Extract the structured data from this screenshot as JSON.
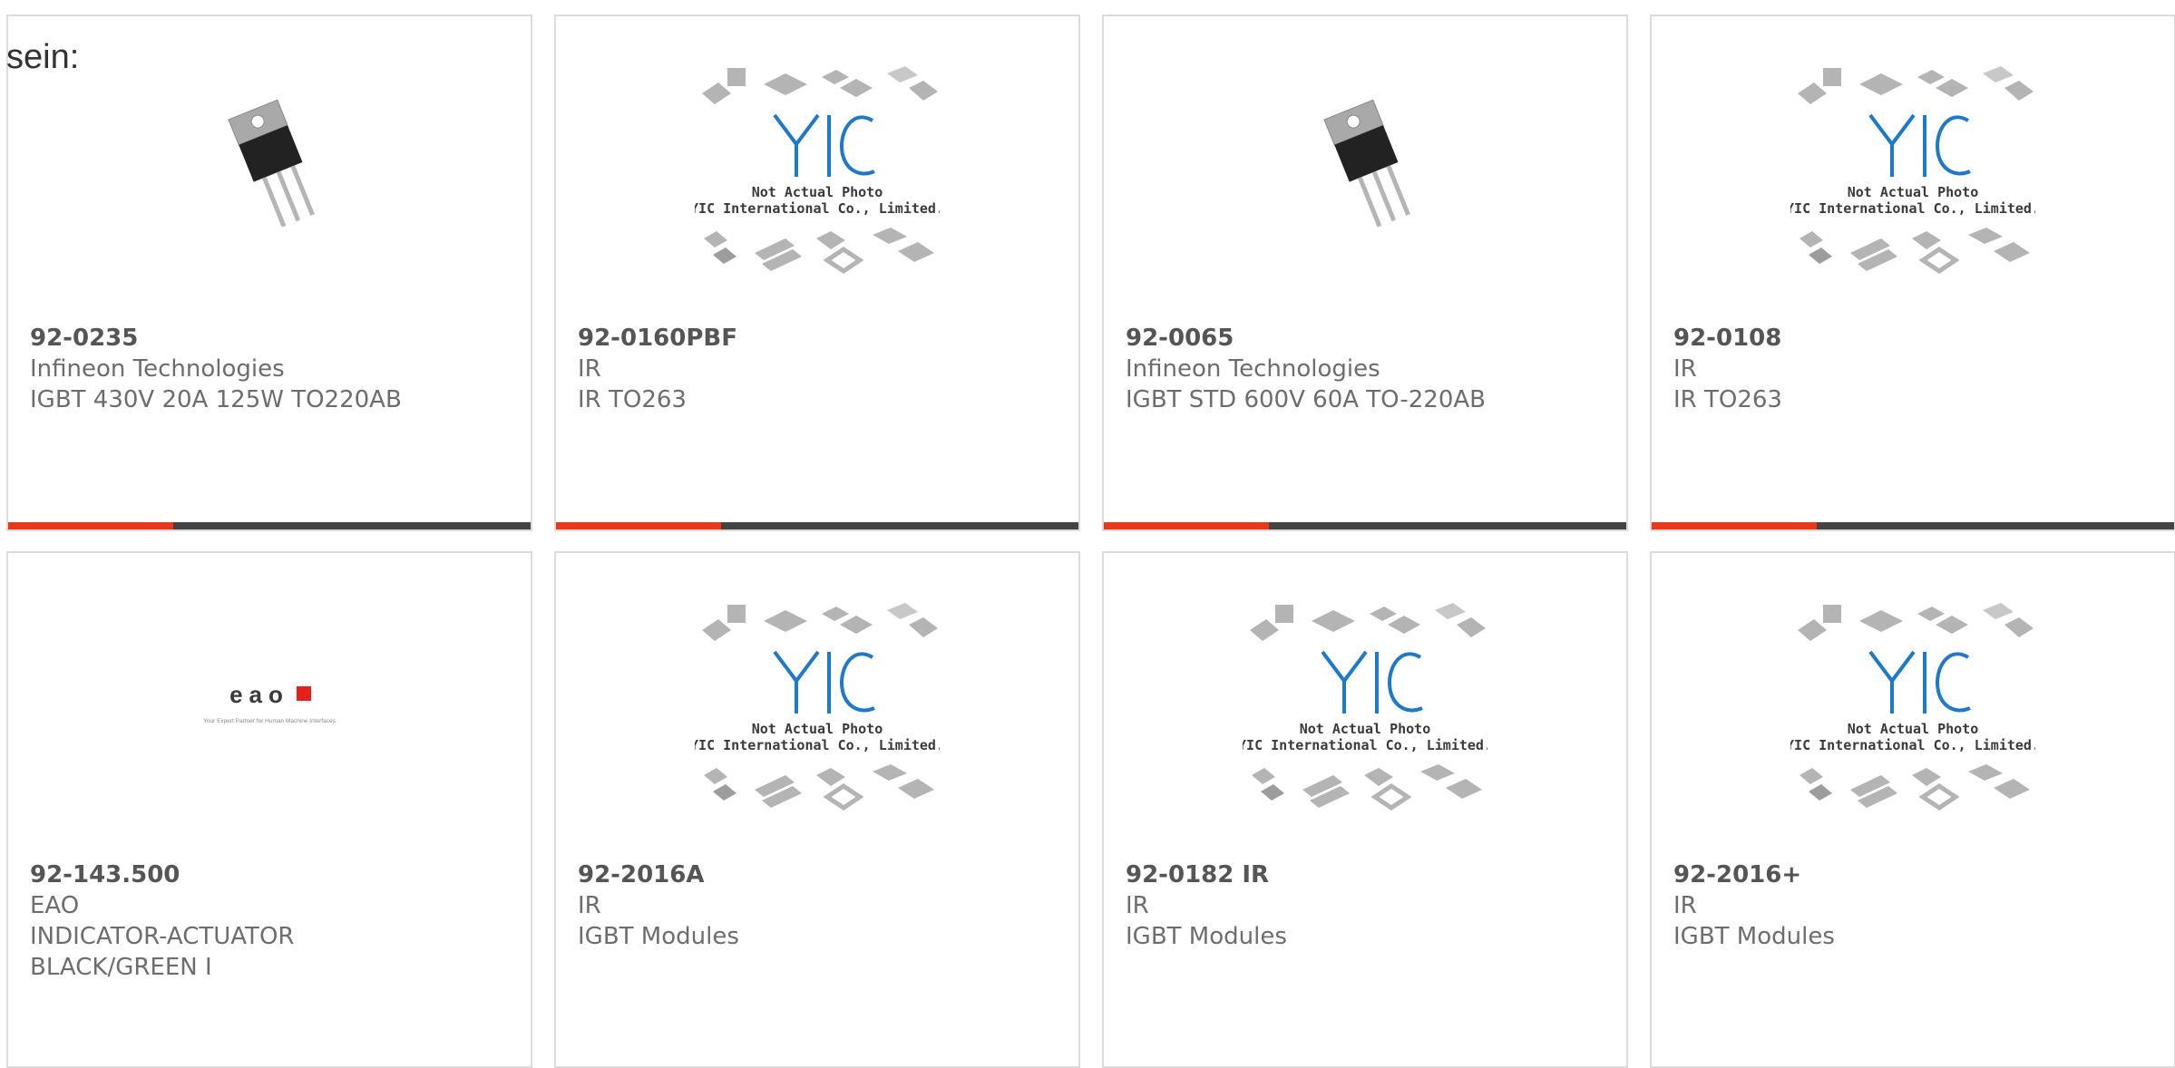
{
  "intro": "sein:",
  "placeholder": {
    "line1": "Not Actual Photo",
    "line2": "YIC International Co., Limited."
  },
  "eao": {
    "brand": "eao",
    "tagline": "Your Expert Partner for Human Machine Interfaces"
  },
  "colors": {
    "accent": "#e8391b",
    "bar": "#444444",
    "yic_blue": "#1f78c8"
  },
  "products": [
    {
      "part": "92-0235",
      "brand": "Infineon Technologies",
      "desc": "IGBT 430V 20A 125W TO220AB",
      "image": "to220-transistor-image"
    },
    {
      "part": "92-0160PBF",
      "brand": "IR",
      "desc": "IR TO263",
      "image": "yic-placeholder-image"
    },
    {
      "part": "92-0065",
      "brand": "Infineon Technologies",
      "desc": "IGBT STD 600V 60A TO-220AB",
      "image": "to220-transistor-image"
    },
    {
      "part": "92-0108",
      "brand": "IR",
      "desc": "IR TO263",
      "image": "yic-placeholder-image"
    },
    {
      "part": "92-143.500",
      "brand": "EAO",
      "desc": "INDICATOR-ACTUATOR",
      "desc2": "BLACK/GREEN I",
      "image": "eao-logo-image"
    },
    {
      "part": "92-2016A",
      "brand": "IR",
      "desc": "IGBT Modules",
      "image": "yic-placeholder-image"
    },
    {
      "part": "92-0182 IR",
      "brand": "IR",
      "desc": "IGBT Modules",
      "image": "yic-placeholder-image"
    },
    {
      "part": "92-2016+",
      "brand": "IR",
      "desc": "IGBT Modules",
      "image": "yic-placeholder-image"
    }
  ]
}
